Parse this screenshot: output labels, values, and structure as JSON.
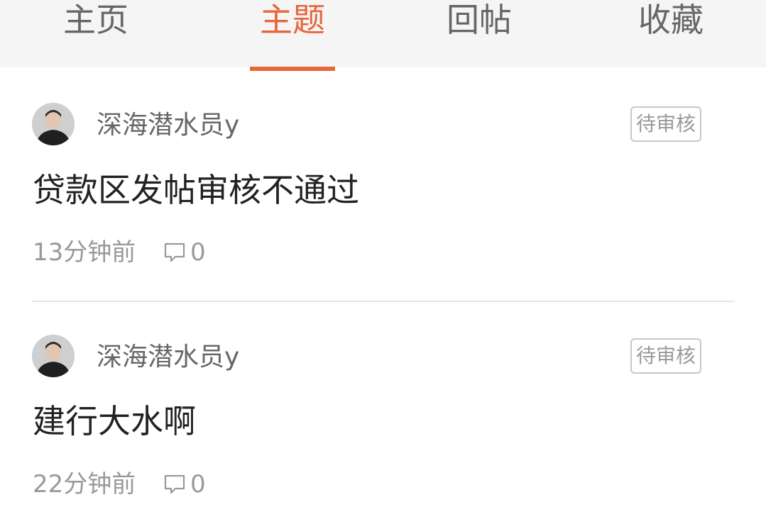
{
  "tabs": [
    {
      "label": "主页",
      "active": false
    },
    {
      "label": "主题",
      "active": true
    },
    {
      "label": "回帖",
      "active": false
    },
    {
      "label": "收藏",
      "active": false
    }
  ],
  "accent_color": "#e8663a",
  "posts": [
    {
      "author": "深海潜水员y",
      "status": "待审核",
      "title": "贷款区发帖审核不通过",
      "time": "13分钟前",
      "comments": "0"
    },
    {
      "author": "深海潜水员y",
      "status": "待审核",
      "title": "建行大水啊",
      "time": "22分钟前",
      "comments": "0"
    }
  ]
}
